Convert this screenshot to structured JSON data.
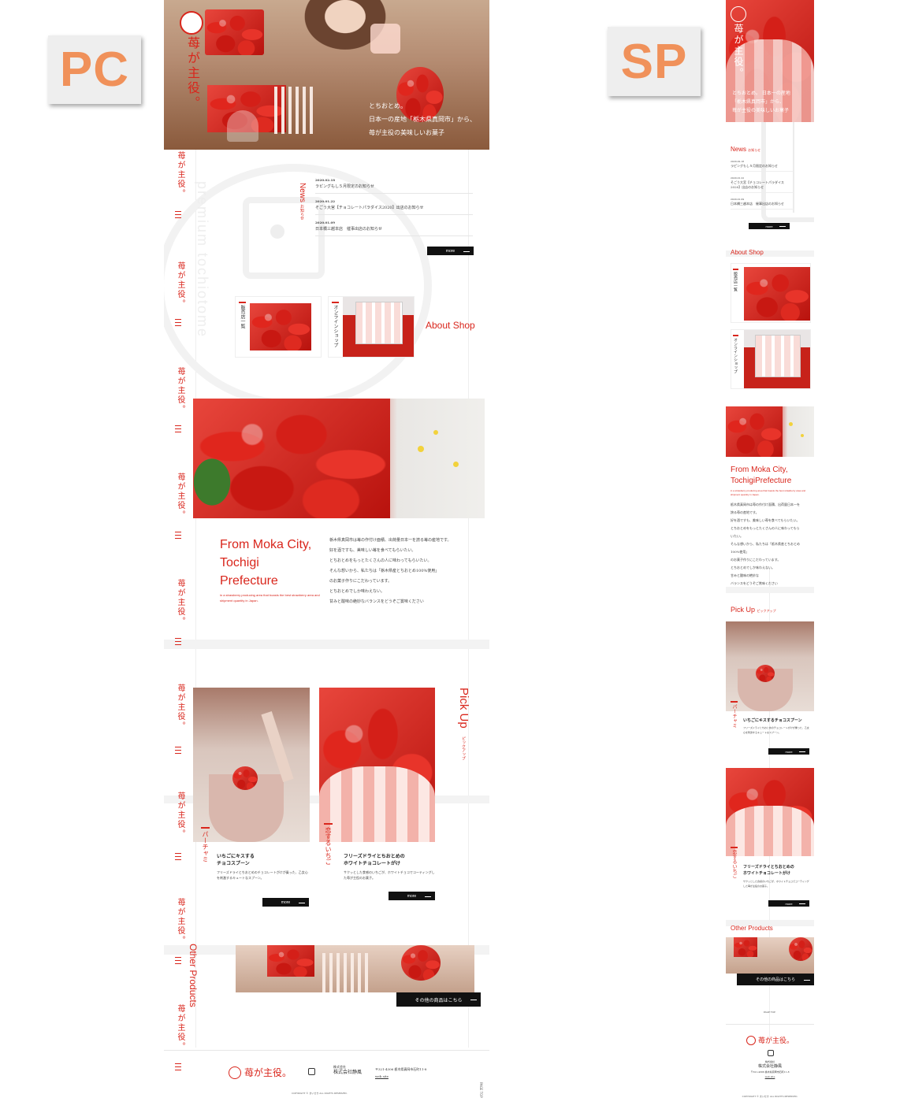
{
  "labels": {
    "pc": "PC",
    "sp": "SP"
  },
  "colors": {
    "accent": "#d9261c",
    "dark": "#111111",
    "label_text": "#f0915a",
    "label_bg": "#eeeeee"
  },
  "brand": {
    "name": "苺が主役。",
    "company_prefix": "株式会社",
    "company": "株式会社静風",
    "address": "〒321-4306 栃木県真岡市石町11-8",
    "web": "web site",
    "copyright": "COPYRIGHT © まいせき ALL RIGHTS RESERVED.",
    "page_top": "PAGE TOP"
  },
  "pc": {
    "hero": {
      "line1": "とちおとめ。",
      "line2": "日本一の産地「栃木県真岡市」から、",
      "line3": "苺が主役の美味しいお菓子"
    },
    "news": {
      "title": "News",
      "subtitle": "お知らせ",
      "items": [
        {
          "date": "2020.02.18",
          "text": "ラピングもし５月限定のお知らせ"
        },
        {
          "date": "2020.01.22",
          "text": "そごう大宮【チョコレートパラダイス2020】出店のお知らせ"
        },
        {
          "date": "2020.01.09",
          "text": "日本橋三越本店　催事出店のお知らせ"
        }
      ],
      "more": "more"
    },
    "side_text": "premium tochiotome",
    "about": {
      "title": "About Shop",
      "tab1": "販売店一覧",
      "tab2": "オンラインショップ"
    },
    "moka": {
      "title_l1": "From Moka City,",
      "title_l2": "Tochigi",
      "title_l3": "Prefecture",
      "sub": "in a strawberry producing area that boasts the best strawberry area and shipment quantity in Japan.",
      "body": [
        "栃木県真岡市は苺の作付け面積、出荷量日本一を誇る苺の産地です。",
        "好を酒ですも、美味しい苺を食べてもらいたい。",
        "とちおとめをもっとたくさんの人に味わってもらいたい。",
        "そんな想いから、私たちは「栃木県産とちおとめ100%使用」",
        "のお菓子作りにこだわっています。",
        "とちおとめでしか味わえない。",
        "甘みと酸味の絶妙なバランスをどうぞご賞味ください"
      ]
    },
    "pickup": {
      "title": "Pick Up",
      "subtitle": "ピックアップ",
      "items": [
        {
          "tag": "パーチャミ",
          "name_l1": "いちごにキスする",
          "name_l2": "チョコスプーン",
          "desc": "フリーズドライとちおとめのチョコレートがけが乗った、乙女心を刺激するキュートなスプーン。",
          "more": "more"
        },
        {
          "tag": "恋するいちご",
          "name_l1": "フリーズドライとちおとめの",
          "name_l2": "ホワイトチョコレートがけ",
          "desc": "サクッとした食感のいちごが、ホワイトチョコでコーティングした苺が主役のお菓子。",
          "more": "more"
        }
      ]
    },
    "other": {
      "title": "Other Products",
      "button": "その他の商品はこちら"
    }
  },
  "sp": {
    "hero": {
      "line1": "とちおとめ。 日本一の産地",
      "line2": "「栃木県真岡市」から、",
      "line3": "苺が主役の美味しいお菓子"
    },
    "news": {
      "title": "News",
      "subtitle": "お知らせ",
      "items": [
        {
          "date": "2020.02.18",
          "text": "ラピングもし５月限定のお知らせ"
        },
        {
          "date": "2020.01.22",
          "text": "そごう大宮【チョコレートパラダイス2020】出店のお知らせ"
        },
        {
          "date": "2020.01.09",
          "text": "日本橋三越本店　催事出店のお知らせ"
        }
      ],
      "more": "more"
    },
    "about": {
      "title": "About Shop",
      "tab1": "販売店一覧",
      "tab2": "オンラインショップ"
    },
    "moka": {
      "title_l1": "From Moka City,",
      "title_l2": "TochigiPrefecture",
      "sub": "in a strawberry producing area that boasts the best strawberry area and shipment quantity in Japan.",
      "body": [
        "栃木県真岡市は苺の作付け面積、出荷量日本一を",
        "誇る苺の産地です。",
        "好を酒ですも、美味しい苺を食べてもらいたい。",
        "とちおとめをもっとたくさんの人に味わってもら",
        "いたい。",
        "そんな想いから、私たちは「栃木県産とちおとめ",
        "100%使用」",
        "のお菓子作りにこだわっています。",
        "とちおとめでしか味わえない。",
        "甘みと酸味の絶妙な",
        "バランスをどうぞご賞味ください"
      ]
    },
    "pickup": {
      "title": "Pick Up",
      "subtitle": "ピックアップ",
      "items": [
        {
          "tag": "パーチャミ",
          "name": "いちごにキスするチョコスプーン",
          "desc": "フリーズドライとちおとめのチョコレートがけが乗った、乙女心を刺激するキュートなスプーン。",
          "more": "more"
        },
        {
          "tag": "恋するいちご",
          "name_l1": "フリーズドライとちおとめの",
          "name_l2": "ホワイトチョコレートがけ",
          "desc": "サクッとした食感のいちごが、ホワイトチョコでコーティングした苺が主役のお菓子。",
          "more": "more"
        }
      ]
    },
    "other": {
      "title": "Other Products",
      "button": "その他の商品はこちら"
    }
  }
}
